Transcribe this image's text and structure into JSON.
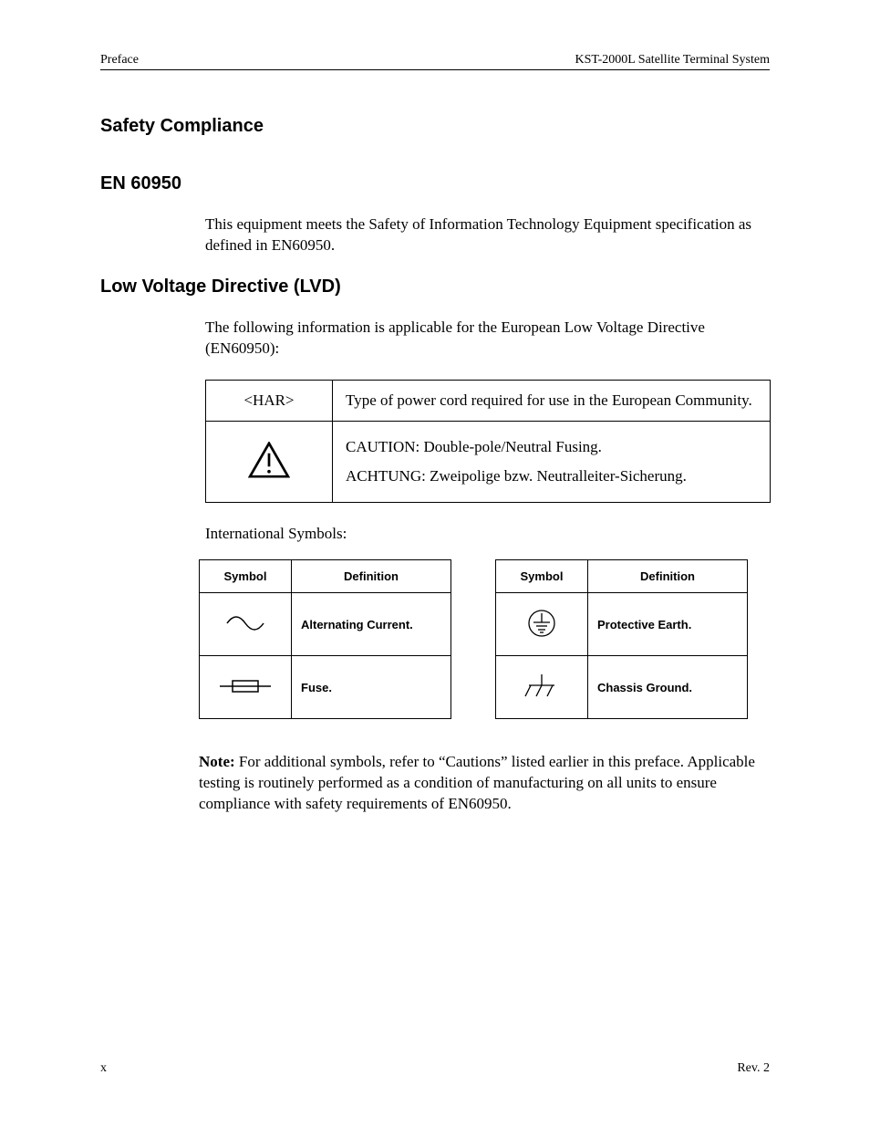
{
  "header": {
    "left": "Preface",
    "right": "KST-2000L Satellite Terminal System"
  },
  "sections": {
    "safety_heading": "Safety Compliance",
    "en60950_heading": "EN 60950",
    "en60950_body": "This equipment meets the Safety of Information Technology Equipment specification as defined in EN60950.",
    "lvd_heading": "Low Voltage Directive (LVD)",
    "lvd_body": "The following information is applicable for the European Low Voltage Directive (EN60950):",
    "lvd_table": {
      "row1_symbol": "<HAR>",
      "row1_text": "Type of power cord required for use in the European Community.",
      "row2_text1": "CAUTION: Double-pole/Neutral Fusing.",
      "row2_text2": "ACHTUNG: Zweipolige bzw. Neutralleiter-Sicherung."
    },
    "intl_symbols_heading": "International Symbols:",
    "sym_headers": {
      "symbol": "Symbol",
      "definition": "Definition"
    },
    "sym_left": [
      {
        "icon": "ac-icon",
        "def": "Alternating Current."
      },
      {
        "icon": "fuse-icon",
        "def": "Fuse."
      }
    ],
    "sym_right": [
      {
        "icon": "protective-earth-icon",
        "def": "Protective Earth."
      },
      {
        "icon": "chassis-ground-icon",
        "def": "Chassis Ground."
      }
    ],
    "note_label": "Note:",
    "note_body": " For additional symbols, refer to “Cautions” listed earlier in this preface. Applicable testing is routinely performed as a condition of manufacturing on all units to ensure compliance with safety requirements of EN60950."
  },
  "footer": {
    "page": "x",
    "rev": "Rev. 2"
  }
}
